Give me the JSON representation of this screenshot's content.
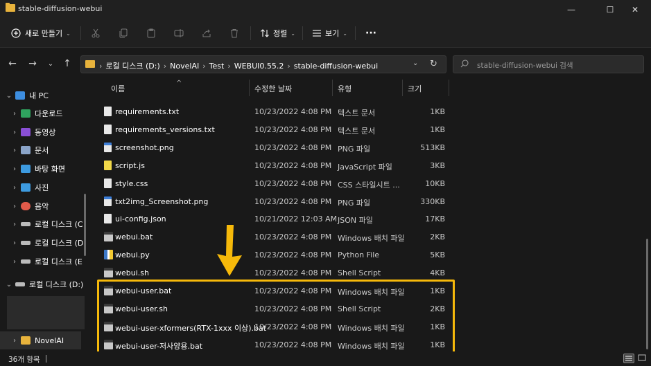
{
  "window": {
    "title": "stable-diffusion-webui",
    "minimize": "—",
    "maximize": "☐",
    "close": "✕"
  },
  "toolbar": {
    "new_label": "새로 만들기",
    "new_icon": "plus-circle-icon",
    "cut_icon": "scissors-icon",
    "copy_icon": "copy-icon",
    "paste_icon": "clipboard-icon",
    "rename_icon": "rename-icon",
    "share_icon": "share-icon",
    "delete_icon": "trash-icon",
    "sort_label": "정렬",
    "view_label": "보기",
    "more_label": "···"
  },
  "address": {
    "crumbs": [
      "로컬 디스크 (D:)",
      "NovelAI",
      "Test",
      "WEBUI0.55.2",
      "stable-diffusion-webui"
    ]
  },
  "search": {
    "placeholder": "stable-diffusion-webui 검색"
  },
  "sidebar": {
    "items": [
      {
        "label": "내 PC",
        "icon": "pc-icon",
        "color": "#3d8ee0"
      },
      {
        "label": "다운로드",
        "icon": "download-icon",
        "color": "#2fa35e"
      },
      {
        "label": "동영상",
        "icon": "video-icon",
        "color": "#8a4fd6"
      },
      {
        "label": "문서",
        "icon": "document-icon",
        "color": "#8aa4c8"
      },
      {
        "label": "바탕 화면",
        "icon": "desktop-icon",
        "color": "#3d9be0"
      },
      {
        "label": "사진",
        "icon": "pictures-icon",
        "color": "#3d9be0"
      },
      {
        "label": "음악",
        "icon": "music-icon",
        "color": "#e05a4a"
      },
      {
        "label": "로컬 디스크 (C",
        "icon": "drive-icon",
        "color": "#bbbbbb"
      },
      {
        "label": "로컬 디스크 (D",
        "icon": "drive-icon",
        "color": "#bbbbbb"
      },
      {
        "label": "로컬 디스크 (E",
        "icon": "drive-icon",
        "color": "#bbbbbb"
      },
      {
        "label": "로컬 디스크 (D:)",
        "icon": "drive-icon",
        "color": "#bbbbbb"
      },
      {
        "label": "NovelAI",
        "icon": "folder-icon",
        "color": "#e8b33c"
      }
    ]
  },
  "columns": {
    "name": "이름",
    "date": "수정한 날짜",
    "type": "유형",
    "size": "크기"
  },
  "files": [
    {
      "name": "requirements.txt",
      "date": "10/23/2022 4:08 PM",
      "type": "텍스트 문서",
      "size": "1KB",
      "kind": "txt"
    },
    {
      "name": "requirements_versions.txt",
      "date": "10/23/2022 4:08 PM",
      "type": "텍스트 문서",
      "size": "1KB",
      "kind": "txt"
    },
    {
      "name": "screenshot.png",
      "date": "10/23/2022 4:08 PM",
      "type": "PNG 파일",
      "size": "513KB",
      "kind": "png"
    },
    {
      "name": "script.js",
      "date": "10/23/2022 4:08 PM",
      "type": "JavaScript 파일",
      "size": "3KB",
      "kind": "js"
    },
    {
      "name": "style.css",
      "date": "10/23/2022 4:08 PM",
      "type": "CSS 스타일시트 ...",
      "size": "10KB",
      "kind": "txt"
    },
    {
      "name": "txt2img_Screenshot.png",
      "date": "10/23/2022 4:08 PM",
      "type": "PNG 파일",
      "size": "330KB",
      "kind": "png"
    },
    {
      "name": "ui-config.json",
      "date": "10/21/2022 12:03 AM",
      "type": "JSON 파일",
      "size": "17KB",
      "kind": "txt"
    },
    {
      "name": "webui.bat",
      "date": "10/23/2022 4:08 PM",
      "type": "Windows 배치 파일",
      "size": "2KB",
      "kind": "bat"
    },
    {
      "name": "webui.py",
      "date": "10/23/2022 4:08 PM",
      "type": "Python File",
      "size": "5KB",
      "kind": "py"
    },
    {
      "name": "webui.sh",
      "date": "10/23/2022 4:08 PM",
      "type": "Shell Script",
      "size": "4KB",
      "kind": "bat"
    },
    {
      "name": "webui-user.bat",
      "date": "10/23/2022 4:08 PM",
      "type": "Windows 배치 파일",
      "size": "1KB",
      "kind": "bat"
    },
    {
      "name": "webui-user.sh",
      "date": "10/23/2022 4:08 PM",
      "type": "Shell Script",
      "size": "2KB",
      "kind": "bat"
    },
    {
      "name": "webui-user-xformers(RTX-1xxx 이상).bat",
      "date": "10/23/2022 4:08 PM",
      "type": "Windows 배치 파일",
      "size": "1KB",
      "kind": "bat"
    },
    {
      "name": "webui-user-저사양용.bat",
      "date": "10/23/2022 4:08 PM",
      "type": "Windows 배치 파일",
      "size": "1KB",
      "kind": "bat"
    }
  ],
  "status": {
    "count": "36개 항목"
  },
  "colors": {
    "highlight": "#f6b90a",
    "arrow": "#f6b90a"
  }
}
